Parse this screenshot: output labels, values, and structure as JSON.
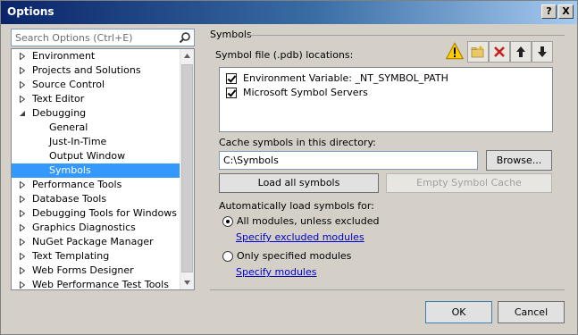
{
  "window": {
    "title": "Options"
  },
  "titlebar_buttons": {
    "help": "?",
    "close": "X"
  },
  "search": {
    "placeholder": "Search Options (Ctrl+E)"
  },
  "tree": {
    "items": [
      {
        "label": "Environment",
        "expanded": false,
        "level": 0
      },
      {
        "label": "Projects and Solutions",
        "expanded": false,
        "level": 0
      },
      {
        "label": "Source Control",
        "expanded": false,
        "level": 0
      },
      {
        "label": "Text Editor",
        "expanded": false,
        "level": 0
      },
      {
        "label": "Debugging",
        "expanded": true,
        "level": 0
      },
      {
        "label": "General",
        "level": 1
      },
      {
        "label": "Just-In-Time",
        "level": 1
      },
      {
        "label": "Output Window",
        "level": 1
      },
      {
        "label": "Symbols",
        "level": 1,
        "selected": true
      },
      {
        "label": "Performance Tools",
        "expanded": false,
        "level": 0
      },
      {
        "label": "Database Tools",
        "expanded": false,
        "level": 0
      },
      {
        "label": "Debugging Tools for Windows",
        "expanded": false,
        "level": 0
      },
      {
        "label": "Graphics Diagnostics",
        "expanded": false,
        "level": 0
      },
      {
        "label": "NuGet Package Manager",
        "expanded": false,
        "level": 0
      },
      {
        "label": "Text Templating",
        "expanded": false,
        "level": 0
      },
      {
        "label": "Web Forms Designer",
        "expanded": false,
        "level": 0
      },
      {
        "label": "Web Performance Test Tools",
        "expanded": false,
        "level": 0
      }
    ]
  },
  "symbols": {
    "section_title": "Symbols",
    "pdb_label": "Symbol file (.pdb) locations:",
    "toolbar_icons": [
      "warning-icon",
      "new-folder-icon",
      "delete-icon",
      "move-up-icon",
      "move-down-icon"
    ],
    "locations": [
      {
        "label": "Environment Variable: _NT_SYMBOL_PATH",
        "checked": true
      },
      {
        "label": "Microsoft Symbol Servers",
        "checked": true
      }
    ],
    "cache_label": "Cache symbols in this directory:",
    "cache_value": "C:\\Symbols",
    "browse_label": "Browse...",
    "load_all_label": "Load all symbols",
    "empty_cache_label": "Empty Symbol Cache",
    "auto_load_label": "Automatically load symbols for:",
    "option_all": "All modules, unless excluded",
    "option_all_link": "Specify excluded modules",
    "option_only": "Only specified modules",
    "option_only_link": "Specify modules",
    "selected_option": "all"
  },
  "footer": {
    "ok_label": "OK",
    "cancel_label": "Cancel"
  }
}
